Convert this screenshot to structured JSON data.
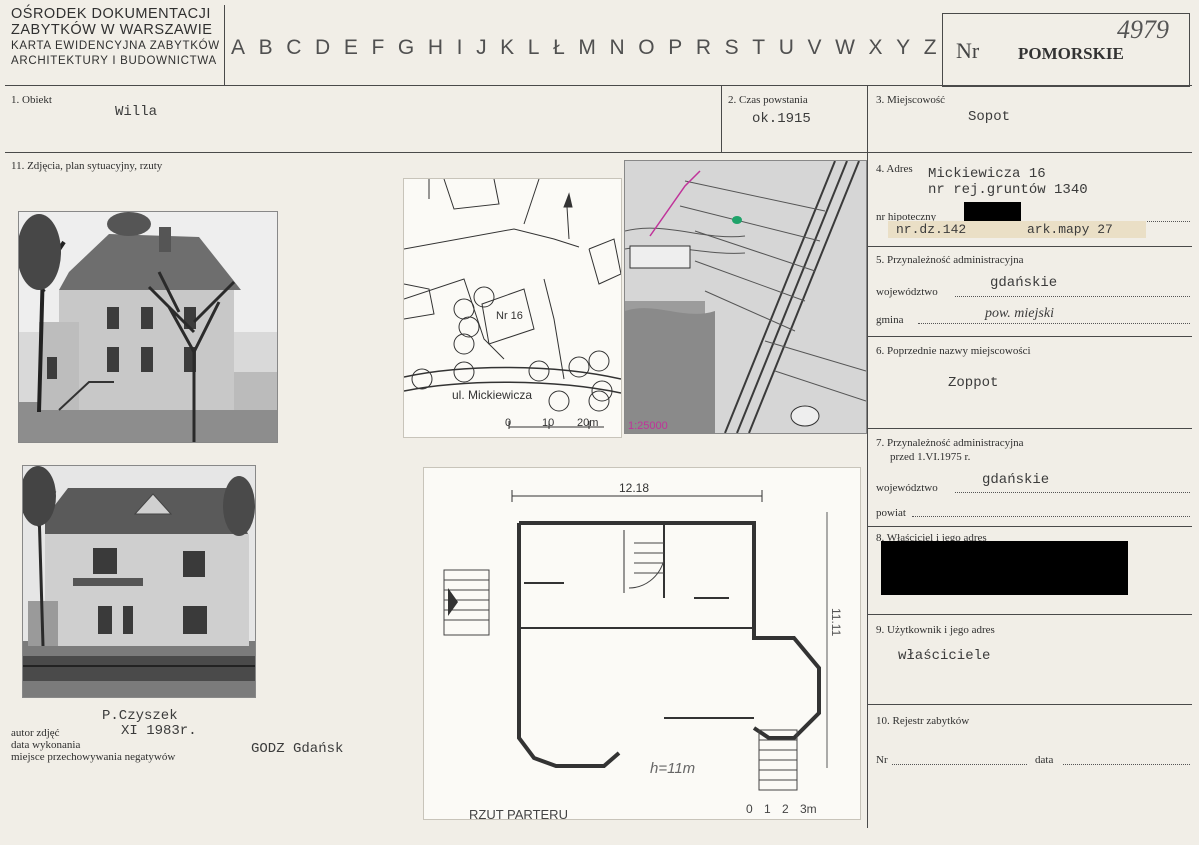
{
  "header": {
    "org_line1": "OŚRODEK DOKUMENTACJI",
    "org_line2": "ZABYTKÓW W WARSZAWIE",
    "org_line3": "KARTA EWIDENCYJNA ZABYTKÓW",
    "org_line4": "ARCHITEKTURY I BUDOWNICTWA",
    "letters": [
      "A",
      "B",
      "C",
      "D",
      "E",
      "F",
      "G",
      "H",
      "I",
      "J",
      "K",
      "L",
      "Ł",
      "M",
      "N",
      "O",
      "P",
      "R",
      "S",
      "T",
      "U",
      "V",
      "W",
      "X",
      "Y",
      "Z"
    ],
    "nr_label": "Nr",
    "nr_stamp": "POMORSKIE",
    "nr_handwritten": "4979"
  },
  "row1": {
    "obiekt_label": "1. Obiekt",
    "obiekt_value": "Willa",
    "czas_label": "2. Czas powstania",
    "czas_value": "ok.1915",
    "miejscowosc_label": "3. Miejscowość",
    "miejscowosc_value": "Sopot"
  },
  "photos": {
    "section_label": "11. Zdjęcia, plan sytuacyjny, rzuty",
    "site_plan_street": "ul. Mickiewicza",
    "site_plan_nr": "Nr 16",
    "site_plan_scale": [
      "0",
      "10",
      "20m"
    ],
    "map_scale": "1:25000",
    "floor_width": "12.18",
    "floor_depth": "11.11",
    "floor_height": "h=11m",
    "floor_caption": "RZUT PARTERU",
    "floor_scale": [
      "0",
      "1",
      "2",
      "3m"
    ],
    "author_label": "autor zdjęć",
    "date_label": "data wykonania",
    "place_label": "miejsce przechowywania negatywów",
    "author_value": "P.Czyszek",
    "date_value": "XI 1983r.",
    "place_value": "GODZ Gdańsk"
  },
  "right": {
    "adres_label": "4. Adres",
    "adres_value1": "Mickiewicza 16",
    "adres_value2": "nr rej.gruntów 1340",
    "hipoteczny_label": "nr hipoteczny",
    "dz_value": "nr.dz.142",
    "mapa_value": "ark.mapy 27",
    "przynaleznosc_label": "5. Przynależność administracyjna",
    "wojewodztwo_label": "województwo",
    "wojewodztwo_value": "gdańskie",
    "gmina_label": "gmina",
    "gmina_value": "pow. miejski",
    "poprzednie_label": "6. Poprzednie nazwy miejscowości",
    "poprzednie_value": "Zoppot",
    "przed_label1": "7. Przynależność administracyjna",
    "przed_label2": "przed 1.VI.1975 r.",
    "woj2_label": "województwo",
    "woj2_value": "gdańskie",
    "powiat_label": "powiat",
    "wlasciciel_label": "8. Właściciel i jego adres",
    "uzytkownik_label": "9. Użytkownik i jego adres",
    "uzytkownik_value": "właściciele",
    "rejestr_label": "10. Rejestr zabytków",
    "nr_label": "Nr",
    "data_label": "data"
  }
}
